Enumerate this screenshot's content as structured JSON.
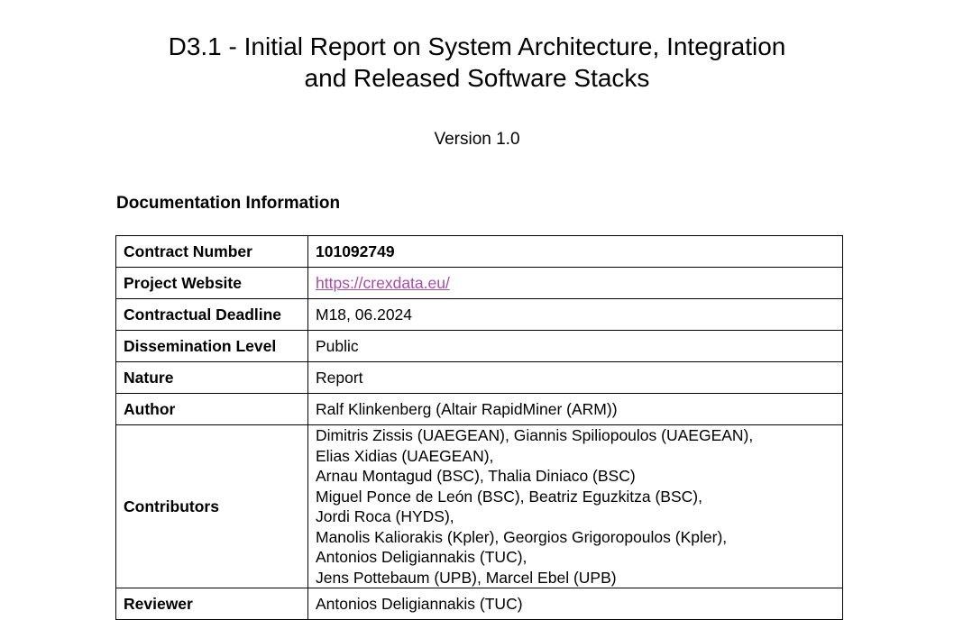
{
  "document": {
    "title_line1": "D3.1 - Initial Report on System Architecture, Integration",
    "title_line2": "and Released Software Stacks",
    "version": "Version 1.0",
    "section_heading": "Documentation Information"
  },
  "table": {
    "rows": [
      {
        "label": "Contract Number",
        "value": "101092749"
      },
      {
        "label": "Project Website",
        "value": "https://crexdata.eu/"
      },
      {
        "label": "Contractual Deadline",
        "value": "M18, 06.2024"
      },
      {
        "label": "Dissemination Level",
        "value": "Public"
      },
      {
        "label": "Nature",
        "value": "Report"
      },
      {
        "label": "Author",
        "value": "Ralf Klinkenberg (Altair RapidMiner (ARM))"
      }
    ],
    "contributors": {
      "label": "Contributors",
      "lines": [
        "Dimitris Zissis (UAEGEAN), Giannis Spiliopoulos (UAEGEAN),",
        "Elias Xidias (UAEGEAN),",
        "Arnau Montagud (BSC), Thalia Diniaco (BSC)",
        "Miguel Ponce de León (BSC), Beatriz Eguzkitza (BSC),",
        "Jordi Roca (HYDS),",
        "Manolis Kaliorakis (Kpler), Georgios Grigoropoulos (Kpler),",
        "Antonios Deligiannakis (TUC),",
        "Jens Pottebaum (UPB), Marcel Ebel (UPB)"
      ]
    },
    "reviewer": {
      "label": "Reviewer",
      "value": "Antonios Deligiannakis (TUC)"
    }
  }
}
